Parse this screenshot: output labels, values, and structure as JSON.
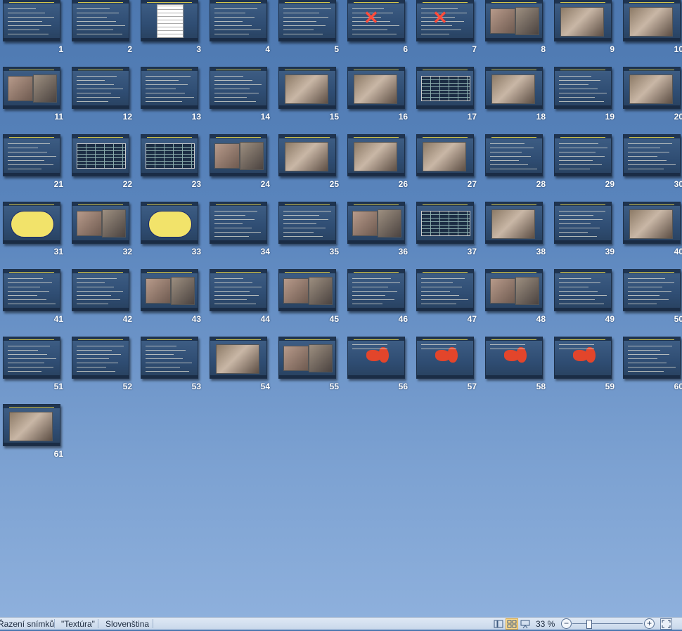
{
  "slides": [
    {
      "number": "1",
      "kind": "text"
    },
    {
      "number": "2",
      "kind": "text"
    },
    {
      "number": "3",
      "kind": "document"
    },
    {
      "number": "4",
      "kind": "text"
    },
    {
      "number": "5",
      "kind": "text"
    },
    {
      "number": "6",
      "kind": "crossed"
    },
    {
      "number": "7",
      "kind": "crossed"
    },
    {
      "number": "8",
      "kind": "photos"
    },
    {
      "number": "9",
      "kind": "photo"
    },
    {
      "number": "10",
      "kind": "photo"
    },
    {
      "number": "11",
      "kind": "photos"
    },
    {
      "number": "12",
      "kind": "text"
    },
    {
      "number": "13",
      "kind": "text"
    },
    {
      "number": "14",
      "kind": "text"
    },
    {
      "number": "15",
      "kind": "photo"
    },
    {
      "number": "16",
      "kind": "photo"
    },
    {
      "number": "17",
      "kind": "table"
    },
    {
      "number": "18",
      "kind": "photo"
    },
    {
      "number": "19",
      "kind": "text"
    },
    {
      "number": "20",
      "kind": "photo"
    },
    {
      "number": "21",
      "kind": "text"
    },
    {
      "number": "22",
      "kind": "table"
    },
    {
      "number": "23",
      "kind": "table"
    },
    {
      "number": "24",
      "kind": "photos"
    },
    {
      "number": "25",
      "kind": "photo"
    },
    {
      "number": "26",
      "kind": "photo"
    },
    {
      "number": "27",
      "kind": "photo"
    },
    {
      "number": "28",
      "kind": "text"
    },
    {
      "number": "29",
      "kind": "text"
    },
    {
      "number": "30",
      "kind": "text"
    },
    {
      "number": "31",
      "kind": "diagram"
    },
    {
      "number": "32",
      "kind": "photos"
    },
    {
      "number": "33",
      "kind": "diagram"
    },
    {
      "number": "34",
      "kind": "text"
    },
    {
      "number": "35",
      "kind": "text"
    },
    {
      "number": "36",
      "kind": "photos"
    },
    {
      "number": "37",
      "kind": "table"
    },
    {
      "number": "38",
      "kind": "photo"
    },
    {
      "number": "39",
      "kind": "text"
    },
    {
      "number": "40",
      "kind": "photo"
    },
    {
      "number": "41",
      "kind": "text"
    },
    {
      "number": "42",
      "kind": "text"
    },
    {
      "number": "43",
      "kind": "photos"
    },
    {
      "number": "44",
      "kind": "text"
    },
    {
      "number": "45",
      "kind": "photos"
    },
    {
      "number": "46",
      "kind": "text"
    },
    {
      "number": "47",
      "kind": "text"
    },
    {
      "number": "48",
      "kind": "photos"
    },
    {
      "number": "49",
      "kind": "text"
    },
    {
      "number": "50",
      "kind": "text"
    },
    {
      "number": "51",
      "kind": "text"
    },
    {
      "number": "52",
      "kind": "text"
    },
    {
      "number": "53",
      "kind": "text"
    },
    {
      "number": "54",
      "kind": "photo"
    },
    {
      "number": "55",
      "kind": "photos"
    },
    {
      "number": "56",
      "kind": "anatomy"
    },
    {
      "number": "57",
      "kind": "anatomy"
    },
    {
      "number": "58",
      "kind": "anatomy"
    },
    {
      "number": "59",
      "kind": "anatomy"
    },
    {
      "number": "60",
      "kind": "text"
    },
    {
      "number": "61",
      "kind": "photo"
    }
  ],
  "statusbar": {
    "view_name": "Řazení snímků",
    "theme": "\"Textúra\"",
    "language": "Slovenština",
    "zoom_level": "33 %",
    "zoom_minus": "−",
    "zoom_plus": "+"
  },
  "colors": {
    "title_yellow": "#f3e14a",
    "slide_bg": "#2f4d73",
    "window_bg": "#5a85bd",
    "statusbar_bg": "#d6e2f0",
    "active_view": "#fbd98a"
  }
}
